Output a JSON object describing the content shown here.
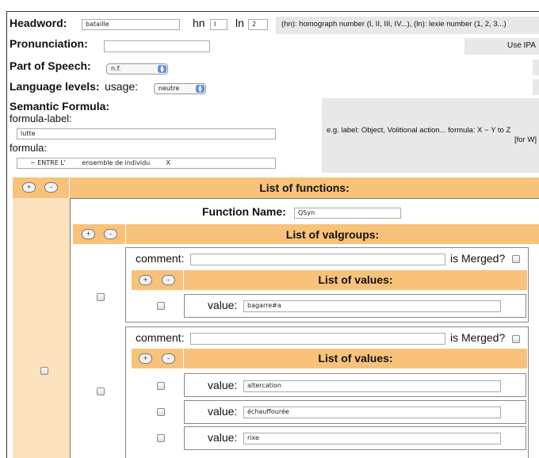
{
  "headword": {
    "label": "Headword:",
    "value": "bataille",
    "hn_label": "hn",
    "hn_value": "I",
    "ln_label": "ln",
    "ln_value": "2",
    "help": "(hn): homograph number (I, II, III, IV...), (ln): lexie number (1, 2, 3...)"
  },
  "pronunciation": {
    "label": "Pronunciation:",
    "value": "",
    "ipa_button": "Use IPA"
  },
  "pos": {
    "label": "Part of Speech:",
    "value": "n.f."
  },
  "language": {
    "label": "Language levels:",
    "usage_label": "usage:",
    "value": "neutre"
  },
  "semantic": {
    "label": "Semantic Formula:",
    "formula_label_label": "formula-label:",
    "formula_label_value": "lutte",
    "formula_label": "formula:",
    "formula_value": "~ ENTRE L'        ensemble de individu        X",
    "help": "e.g. label: Object, Volitional action... formula: X ~ Y to Z",
    "help2": "[for W]"
  },
  "functions": {
    "header": "List of functions:",
    "function_name_label": "Function Name:",
    "function_name_value": "QSyn",
    "valgroups_header": "List of valgroups:",
    "groups": [
      {
        "comment_label": "comment:",
        "comment_value": "",
        "merged_label": "is Merged?",
        "values_header": "List of values:",
        "values": [
          {
            "label": "value:",
            "value": "bagarre#a"
          }
        ]
      },
      {
        "comment_label": "comment:",
        "comment_value": "",
        "merged_label": "is Merged?",
        "values_header": "List of values:",
        "values": [
          {
            "label": "value:",
            "value": "altercation"
          },
          {
            "label": "value:",
            "value": "échauffourée"
          },
          {
            "label": "value:",
            "value": "rixe"
          }
        ]
      }
    ]
  },
  "buttons": {
    "plus": "+",
    "minus": "-"
  },
  "colors": {
    "header_orange": "#f8c27a",
    "gray_panel": "#e8e8e8"
  }
}
